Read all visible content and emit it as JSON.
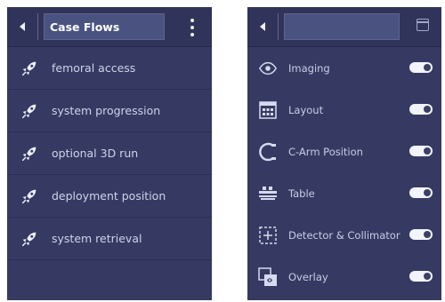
{
  "case_flows_panel": {
    "title": "Case Flows",
    "items": [
      {
        "label": "femoral access",
        "icon": "rocket-icon"
      },
      {
        "label": "system progression",
        "icon": "rocket-icon"
      },
      {
        "label": "optional 3D run",
        "icon": "rocket-icon"
      },
      {
        "label": "deployment position",
        "icon": "rocket-icon"
      },
      {
        "label": "system retrieval",
        "icon": "rocket-icon"
      }
    ]
  },
  "settings_panel": {
    "title": "",
    "items": [
      {
        "label": "Imaging",
        "icon": "eye-icon",
        "enabled": true
      },
      {
        "label": "Layout",
        "icon": "grid-icon",
        "enabled": true
      },
      {
        "label": "C-Arm Position",
        "icon": "c-arm-icon",
        "enabled": true
      },
      {
        "label": "Table",
        "icon": "table-icon",
        "enabled": true
      },
      {
        "label": "Detector & Collimator",
        "icon": "detector-icon",
        "enabled": true
      },
      {
        "label": "Overlay",
        "icon": "overlay-icon",
        "enabled": true
      }
    ]
  },
  "colors": {
    "panel_bg": "#363a62",
    "header_bg": "#30345a",
    "title_box_bg": "#4a537f",
    "text": "#cfd2ea",
    "toggle_on": "#f3f4fb"
  }
}
